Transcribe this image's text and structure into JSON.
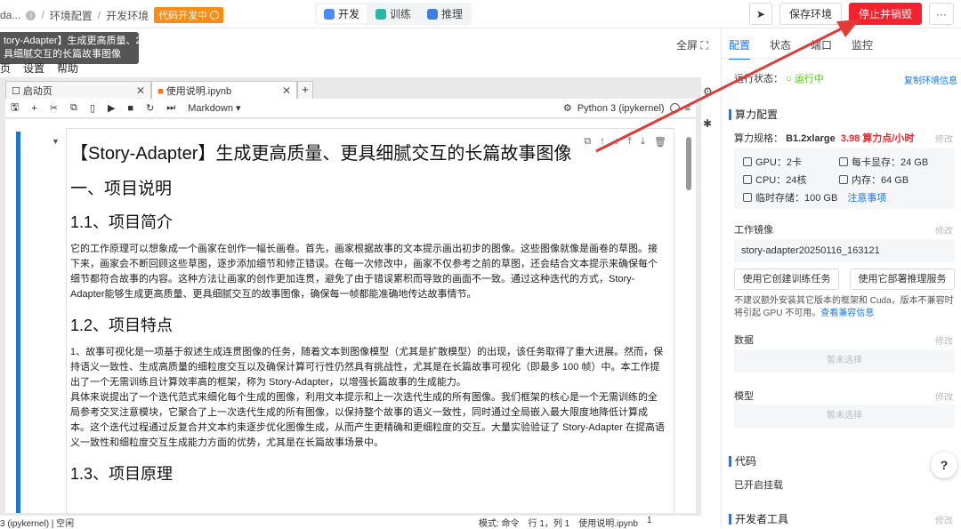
{
  "header": {
    "crumb_partial": "da...",
    "crumb_1": "环境配置",
    "crumb_2": "开发环境",
    "status_badge": "代码开发中",
    "modes": [
      "开发",
      "训练",
      "推理"
    ],
    "save_label": "保存环境",
    "stop_label": "停止并销毁",
    "more": "···"
  },
  "tooltip": {
    "line1": "tory-Adapter】生成更高质量、2",
    "line2": "具细腻交互的长篇故事图像"
  },
  "menu": [
    "页",
    "设置",
    "帮助"
  ],
  "fullscreen": "全屏",
  "jupyter": {
    "tabs": [
      {
        "label": "启动页"
      },
      {
        "label": "使用说明.ipynb"
      }
    ],
    "cell_type": "Markdown",
    "kernel": "Python 3 (ipykernel)"
  },
  "notebook": {
    "title": "【Story-Adapter】生成更高质量、更具细腻交互的长篇故事图像",
    "h_intro": "一、项目说明",
    "h_brief": "1.1、项目简介",
    "p_brief": "它的工作原理可以想象成一个画家在创作一幅长画卷。首先，画家根据故事的文本提示画出初步的图像。这些图像就像是画卷的草图。接下来，画家会不断回顾这些草图，逐步添加细节和修正错误。在每一次修改中，画家不仅参考之前的草图，还会结合文本提示来确保每个细节都符合故事的内容。这种方法让画家的创作更加连贯，避免了由于错误累积而导致的画面不一致。通过这种迭代的方式，Story-Adapter能够生成更高质量、更具细腻交互的故事图像，确保每一帧都能准确地传达故事情节。",
    "h_feat": "1.2、项目特点",
    "p_feat1": "1、故事可视化是一项基于叙述生成连贯图像的任务，随着文本到图像模型（尤其是扩散模型）的出现，该任务取得了重大进展。然而，保持语义一致性、生成高质量的细粒度交互以及确保计算可行性仍然具有挑战性，尤其是在长篇故事可视化（即最多 100 帧）中。本工作提出了一个无需训练且计算效率高的框架，称为 Story-Adapter，以增强长篇故事的生成能力。",
    "p_feat2": "具体来说提出了一个迭代范式来细化每个生成的图像，利用文本提示和上一次迭代生成的所有图像。我们框架的核心是一个无需训练的全局参考交叉注意模块，它聚合了上一次迭代生成的所有图像，以保持整个故事的语义一致性，同时通过全局嵌入最大限度地降低计算成本。这个迭代过程通过反复合并文本约束逐步优化图像生成，从而产生更精确和更细粒度的交互。大量实验验证了 Story-Adapter 在提高语义一致性和细粒度交互生成能力方面的优势，尤其是在长篇故事场景中。",
    "h_principle": "1.3、项目原理"
  },
  "status_bar": {
    "left": "3 (ipykernel) | 空闲",
    "mode": "模式: 命令",
    "pos": "行 1，列 1",
    "file": "使用说明.ipynb",
    "num": "1"
  },
  "panel": {
    "tabs": [
      "配置",
      "状态",
      "端口",
      "监控"
    ],
    "run_label": "运行状态：",
    "run_value": "运行中",
    "copy_link": "复制环境信息",
    "sec_compute": "算力配置",
    "spec_label": "算力规格：",
    "spec_value": "B1.2xlarge",
    "spec_price": "3.98 算力点/小时",
    "edit": "修改",
    "gpu": "GPU：2卡",
    "vram": "每卡显存：24 GB",
    "cpu": "CPU：24核",
    "mem": "内存：64 GB",
    "disk": "临时存储：100 GB",
    "notice": "注意事项",
    "img_label": "工作镜像",
    "img_value": "story-adapter20250116_163121",
    "btn_train": "使用它创建训练任务",
    "btn_infer": "使用它部署推理服务",
    "warn": "不建议额外安装其它版本的框架和 Cuda，版本不兼容时将引起 GPU 不可用。",
    "warn_link": "查看兼容信息",
    "data_label": "数据",
    "model_label": "模型",
    "empty": "暂未选择",
    "sec_code": "代码",
    "code_value": "已开启挂载",
    "sec_dev": "开发者工具",
    "help": "?"
  },
  "colors": {
    "accent": "#1677ff",
    "danger": "#f5222d",
    "badge": "#fa8c16",
    "cell_bar": "#1976d2"
  }
}
